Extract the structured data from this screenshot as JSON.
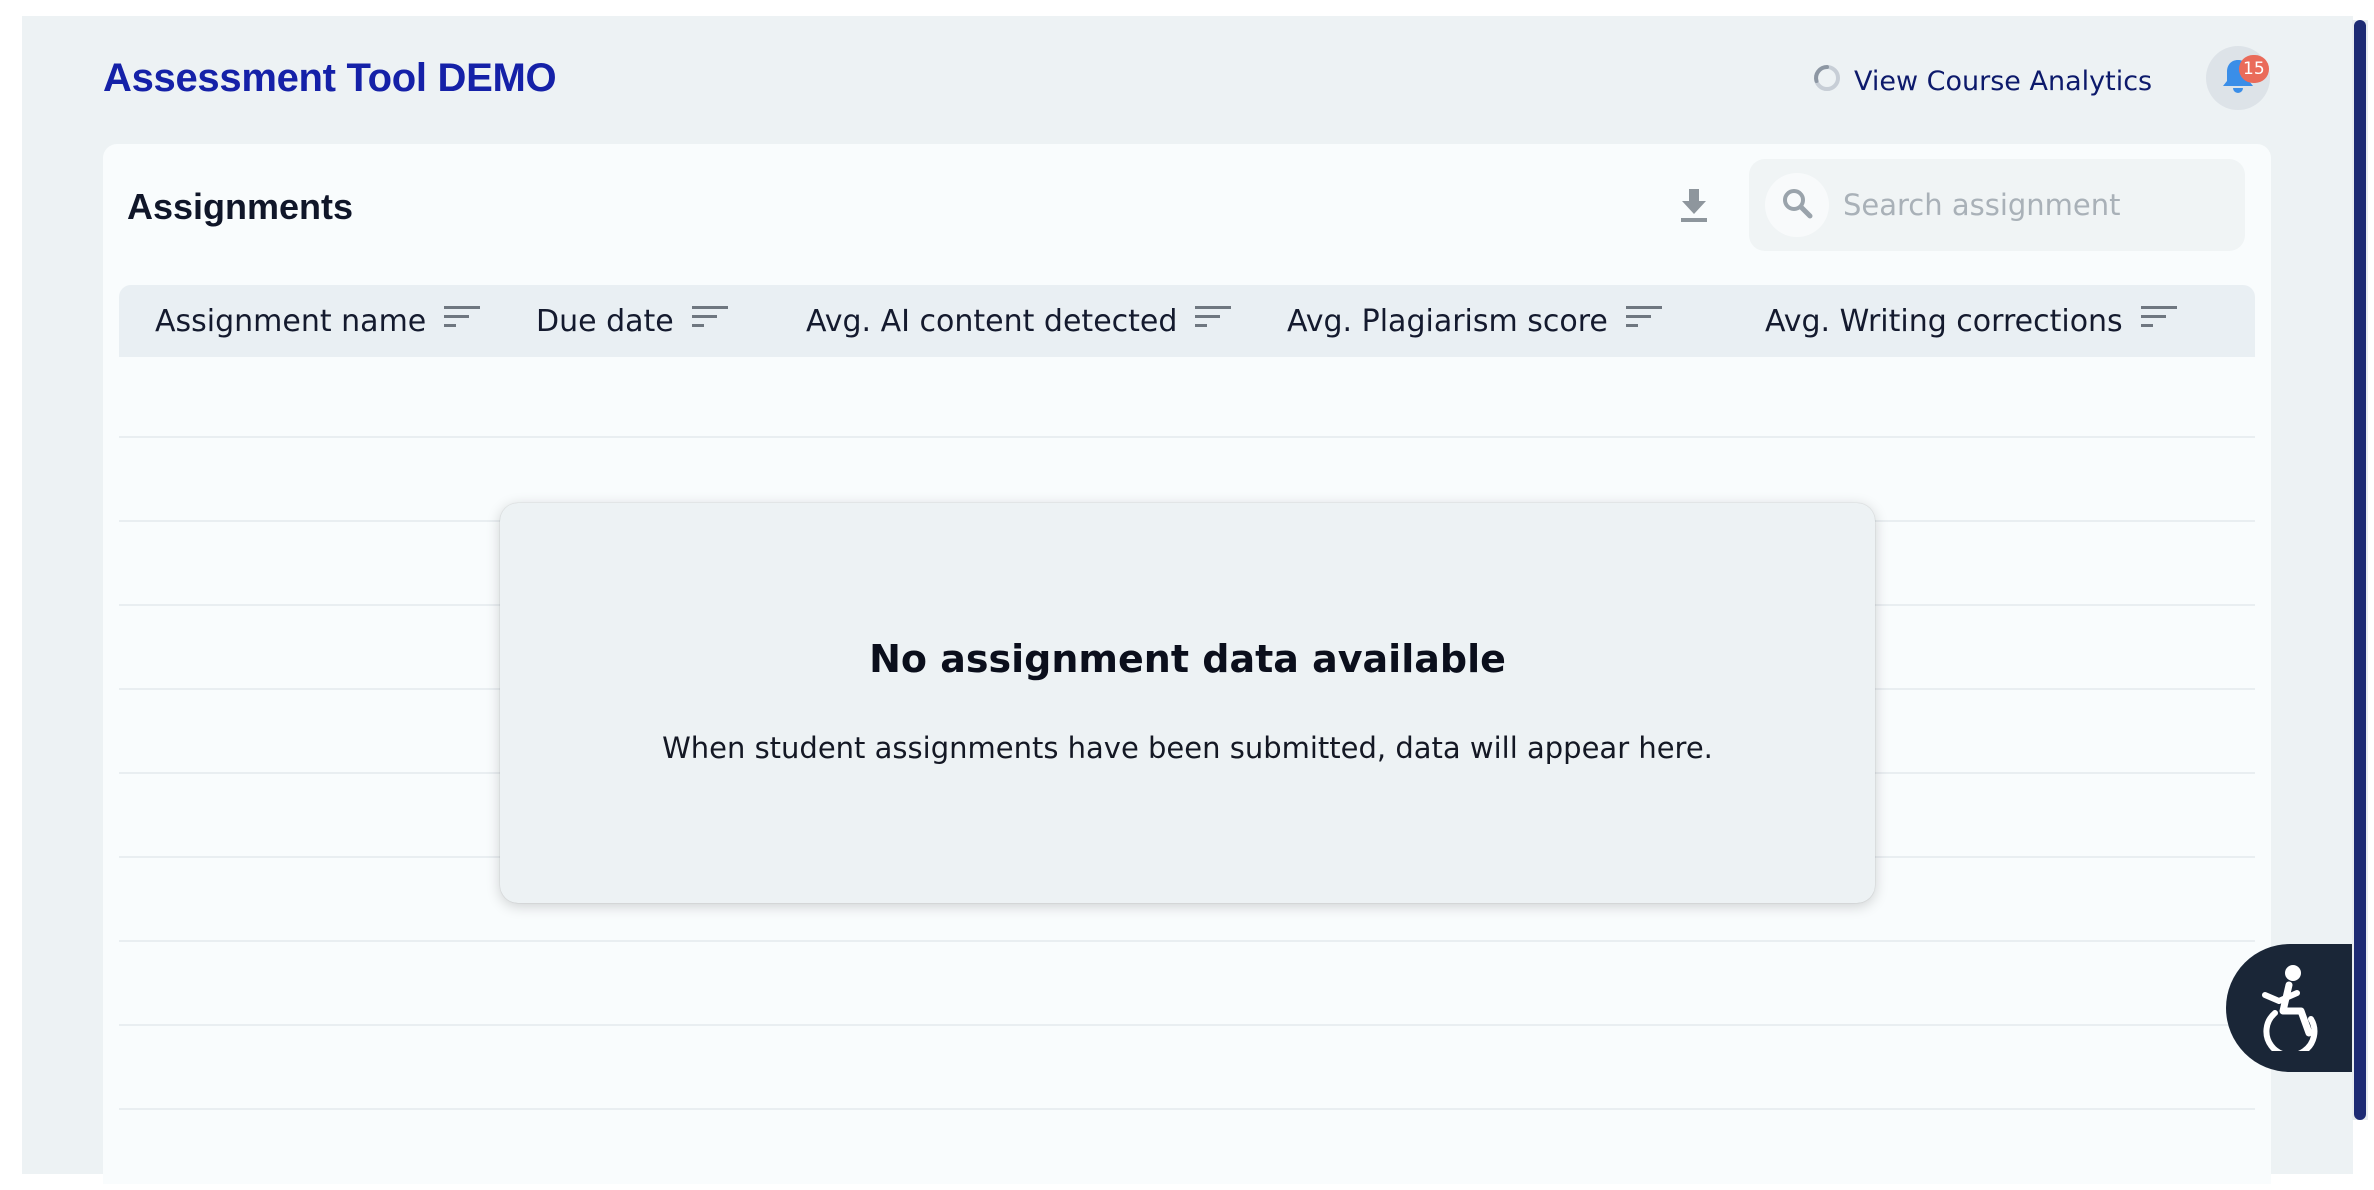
{
  "header": {
    "app_title": "Assessment Tool DEMO",
    "analytics_label": "View Course Analytics",
    "notification_count": "15"
  },
  "assignments": {
    "title": "Assignments",
    "search_placeholder": "Search assignment",
    "columns": [
      {
        "label": "Assignment name"
      },
      {
        "label": "Due date"
      },
      {
        "label": "Avg. AI content detected"
      },
      {
        "label": "Avg. Plagiarism score"
      },
      {
        "label": "Avg. Writing corrections"
      }
    ],
    "empty_state": {
      "title": "No assignment data available",
      "message": "When student assignments have been submitted, data will appear here."
    }
  },
  "icons": {
    "analytics": "loading-ring-icon",
    "notifications": "bell-icon",
    "download": "download-icon",
    "search": "search-icon",
    "sort": "sort-lines-icon",
    "accessibility": "accessibility-icon"
  },
  "colors": {
    "brand": "#1521a8",
    "badge": "#ea6b5a",
    "bell": "#3a8ee8",
    "accessibility_bg": "#1a2637",
    "scroll_thumb": "#1d2a73"
  }
}
